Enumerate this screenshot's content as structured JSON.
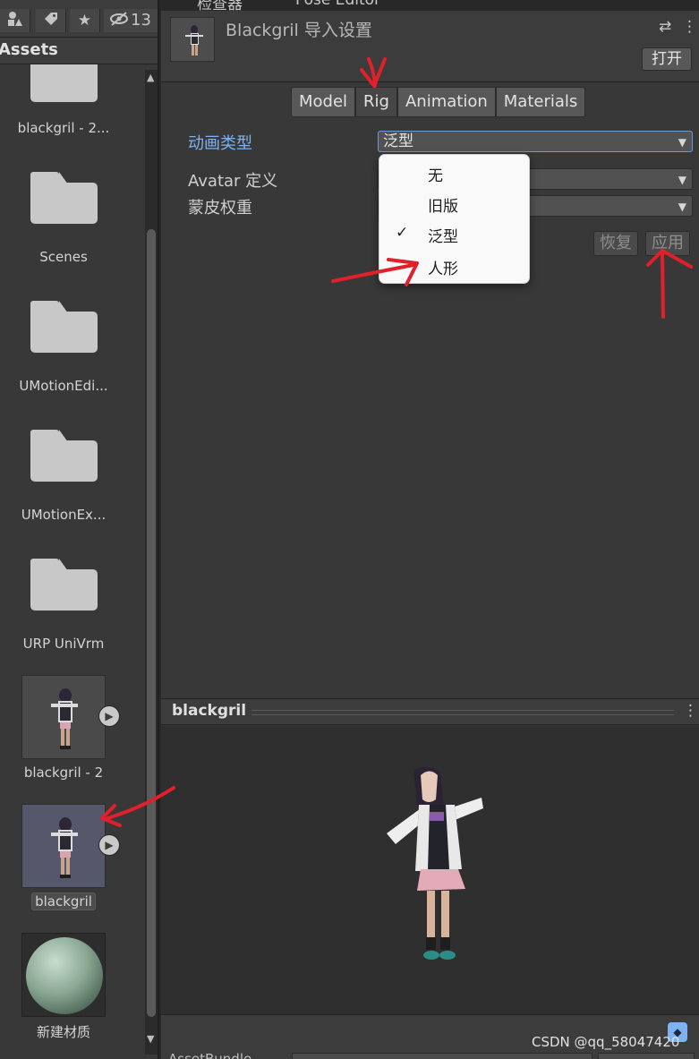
{
  "project_panel": {
    "toolbar": {
      "hidden_count": "13"
    },
    "header": "Assets",
    "items": [
      {
        "label": "blackgril - 2...",
        "kind": "folder"
      },
      {
        "label": "Scenes",
        "kind": "folder"
      },
      {
        "label": "UMotionEdi...",
        "kind": "folder"
      },
      {
        "label": "UMotionEx...",
        "kind": "folder"
      },
      {
        "label": "URP UniVrm",
        "kind": "folder"
      },
      {
        "label": "blackgril - 2",
        "kind": "model"
      },
      {
        "label": "blackgril",
        "kind": "model",
        "selected": true
      },
      {
        "label": "新建材质",
        "kind": "material"
      }
    ]
  },
  "inspector": {
    "tabs": [
      "检查器",
      "Pose Editor"
    ],
    "header": {
      "title": "Blackgril 导入设置",
      "open_label": "打开"
    },
    "import_tabs": [
      "Model",
      "Rig",
      "Animation",
      "Materials"
    ],
    "active_tab": "Rig",
    "fields": {
      "animation_type": {
        "label": "动画类型",
        "value": "泛型"
      },
      "avatar": {
        "label": "Avatar 定义",
        "value": ""
      },
      "skin_weights": {
        "label": "蒙皮权重",
        "value": ""
      }
    },
    "popup": {
      "options": [
        "无",
        "旧版",
        "泛型",
        "人形"
      ],
      "checked": "泛型"
    },
    "buttons": {
      "revert": "恢复",
      "apply": "应用"
    },
    "preview": {
      "title": "blackgril"
    },
    "footer": {
      "label": "AssetBundle"
    }
  },
  "watermark": "CSDN @qq_58047420",
  "colors": {
    "accent_blue": "#7fb2f0",
    "panel_bg": "#383838",
    "annotation_red": "#e0202a"
  }
}
